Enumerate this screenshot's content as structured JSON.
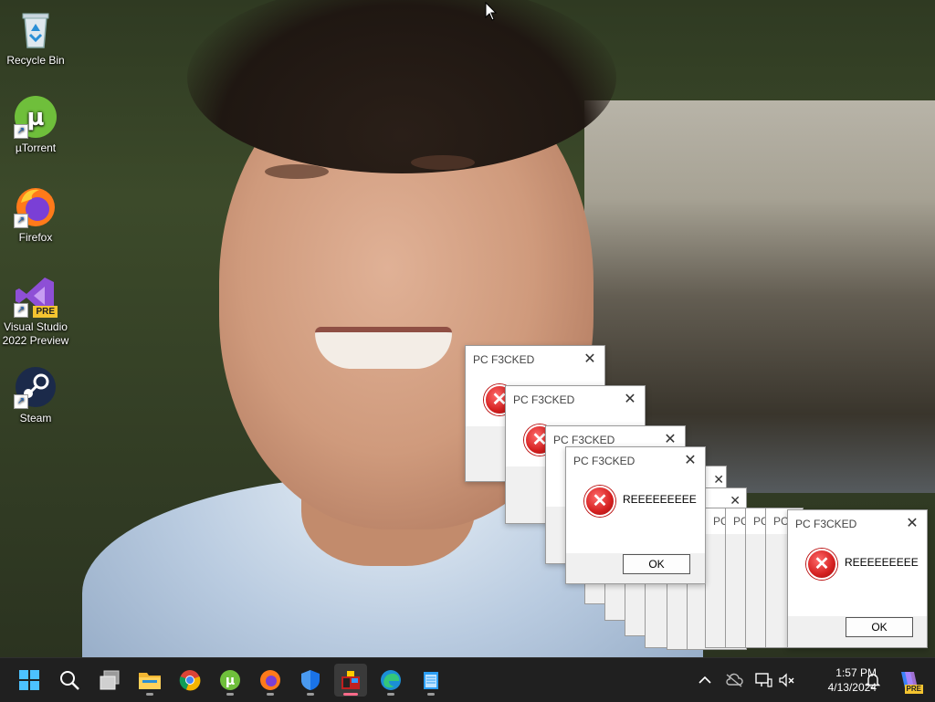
{
  "desktop": {
    "icons": [
      {
        "label": "Recycle Bin",
        "icon": "recycle-bin-icon"
      },
      {
        "label": "µTorrent",
        "icon": "utorrent-icon"
      },
      {
        "label": "Firefox",
        "icon": "firefox-icon"
      },
      {
        "label": "Visual Studio 2022 Preview",
        "icon": "visual-studio-icon",
        "badge": "PRE"
      },
      {
        "label": "Steam",
        "icon": "steam-icon"
      }
    ]
  },
  "dialog": {
    "title": "PC F3CKED",
    "message": "REEEEEEEEE",
    "ok_label": "OK",
    "stub_title": "PC"
  },
  "taskbar": {
    "apps": [
      "start-icon",
      "search-icon",
      "task-view-icon",
      "file-explorer-icon",
      "chrome-icon",
      "utorrent-icon",
      "firefox-icon",
      "windows-security-icon",
      "malware-app-icon",
      "edge-icon",
      "notepad-icon"
    ],
    "time": "1:57 PM",
    "date": "4/13/2024",
    "copilot_badge": "PRE"
  },
  "colors": {
    "taskbar_bg": "#202020",
    "error_red": "#d42020",
    "active_indicator": "#ff6b8a"
  }
}
